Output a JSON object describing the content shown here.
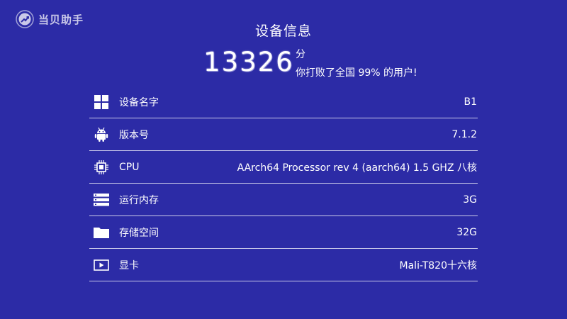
{
  "app": {
    "logo_text": "当贝助手"
  },
  "header": {
    "title": "设备信息",
    "score": "13326",
    "score_unit": "分",
    "score_desc": "你打败了全国 99% 的用户!"
  },
  "rows": [
    {
      "icon": "windows-grid-icon",
      "label": "设备名字",
      "value": "B1"
    },
    {
      "icon": "android-icon",
      "label": "版本号",
      "value": "7.1.2"
    },
    {
      "icon": "cpu-chip-icon",
      "label": "CPU",
      "value": "AArch64 Processor rev 4 (aarch64) 1.5 GHZ 八核"
    },
    {
      "icon": "memory-icon",
      "label": "运行内存",
      "value": "3G"
    },
    {
      "icon": "folder-icon",
      "label": "存储空间",
      "value": "32G"
    },
    {
      "icon": "video-card-icon",
      "label": "显卡",
      "value": "Mali-T820十六核"
    }
  ],
  "colors": {
    "background": "#2c2ba6",
    "text": "#ffffff"
  }
}
